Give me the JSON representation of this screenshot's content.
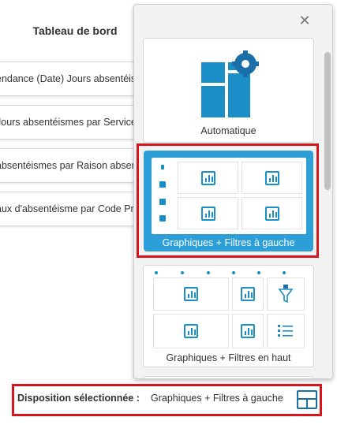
{
  "dashboard": {
    "title": "Tableau de bord",
    "items": [
      "endance (Date) Jours absentéismes",
      " Jours absentéismes par Service",
      " absentéismes par Raison absence",
      "aux d'absentéisme par Code Profil"
    ]
  },
  "layout_panel": {
    "close_symbol": "✕",
    "options": [
      {
        "label": "Automatique",
        "icon": "auto-layout-icon"
      },
      {
        "label": "Graphiques + Filtres à gauche",
        "icon": "filters-left-layout-icon",
        "selected": true
      },
      {
        "label": "Graphiques + Filtres en haut",
        "icon": "filters-top-layout-icon"
      }
    ]
  },
  "footer": {
    "selected_label": "Disposition sélectionnée :",
    "selected_value": "Graphiques + Filtres à gauche"
  },
  "colors": {
    "accent": "#2c9fd9",
    "icon_blue": "#1a8fc7",
    "highlight_red": "#d7141b"
  }
}
